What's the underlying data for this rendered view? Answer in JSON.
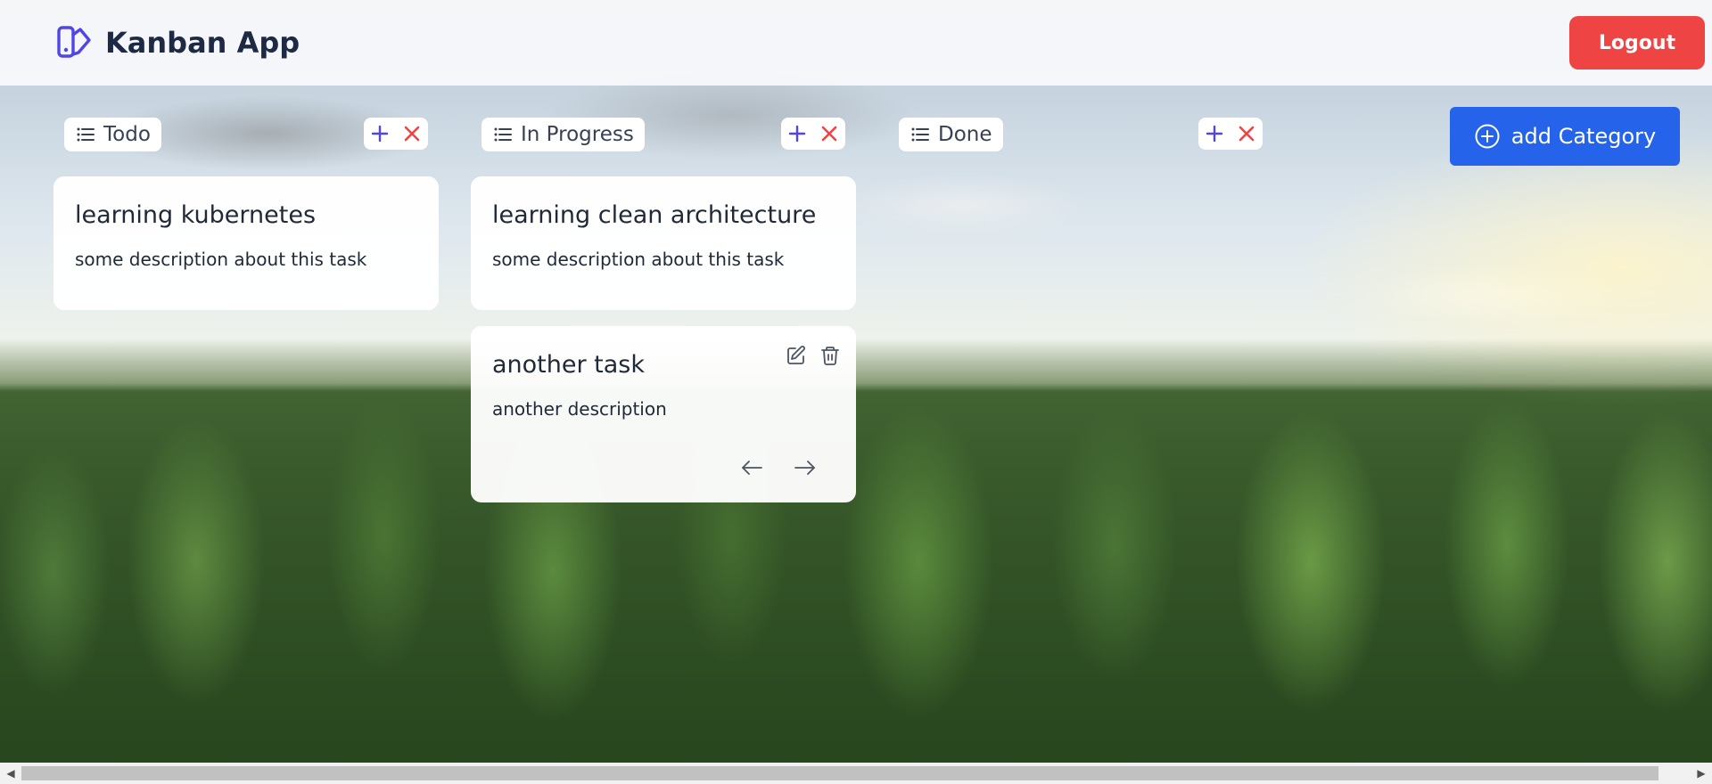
{
  "app": {
    "title": "Kanban App",
    "logout_label": "Logout",
    "add_category_label": "add Category"
  },
  "columns": [
    {
      "title": "Todo",
      "cards": [
        {
          "title": "learning kubernetes",
          "description": "some description about this task"
        }
      ]
    },
    {
      "title": "In Progress",
      "cards": [
        {
          "title": "learning clean architecture",
          "description": "some description about this task"
        },
        {
          "title": "another task",
          "description": "another description"
        }
      ]
    },
    {
      "title": "Done",
      "cards": []
    }
  ],
  "icons": {
    "brand": "kanban-logo-icon",
    "column_title": "list-icon",
    "add_task": "plus-icon",
    "delete_column": "close-icon",
    "edit_task": "edit-icon",
    "delete_task": "trash-icon",
    "move_left": "arrow-left-icon",
    "move_right": "arrow-right-icon",
    "add_category": "circle-plus-icon"
  },
  "colors": {
    "logout": "#ef4444",
    "add_category": "#2563eb",
    "brand_icon": "#4f46e5",
    "plus": "#4f46e5",
    "close": "#ef4444"
  }
}
